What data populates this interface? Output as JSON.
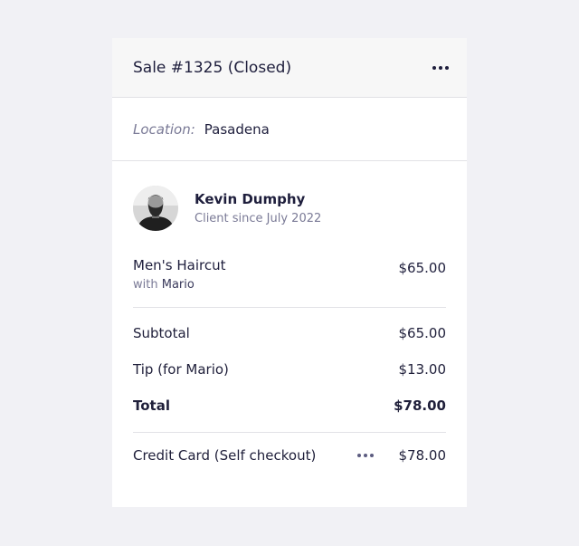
{
  "sale": {
    "title": "Sale #1325 (Closed)",
    "location_label": "Location:",
    "location_value": "Pasadena"
  },
  "client": {
    "name": "Kevin Dumphy",
    "since": "Client since July 2022"
  },
  "service": {
    "name": "Men's Haircut",
    "with_label": "with",
    "staff": "Mario",
    "amount": "$65.00"
  },
  "totals": {
    "subtotal_label": "Subtotal",
    "subtotal_value": "$65.00",
    "tip_label": "Tip (for Mario)",
    "tip_value": "$13.00",
    "total_label": "Total",
    "total_value": "$78.00"
  },
  "payment": {
    "label": "Credit Card (Self checkout)",
    "amount": "$78.00"
  },
  "icons": {
    "header_menu": "more-horizontal-icon",
    "payment_menu": "more-horizontal-icon"
  },
  "colors": {
    "background": "#f1f1f5",
    "text": "#1e1e3c",
    "muted": "#7a7a96",
    "divider": "#e2e2e6"
  }
}
